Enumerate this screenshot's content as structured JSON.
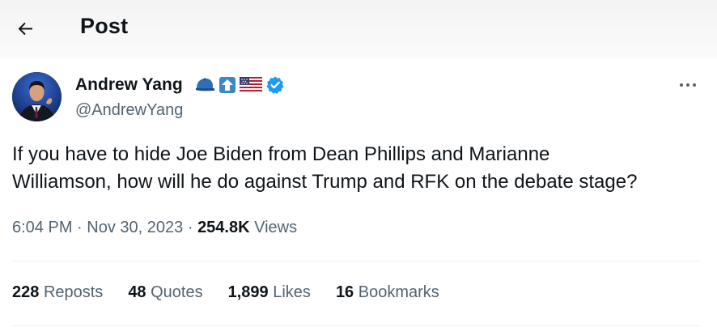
{
  "header": {
    "back_icon": "arrow-left-icon",
    "title": "Post"
  },
  "post": {
    "author": {
      "name": "Andrew Yang",
      "handle": "@AndrewYang",
      "badges": [
        "blue-cap-icon",
        "up-arrow-icon",
        "us-flag-icon",
        "verified-badge-icon"
      ]
    },
    "more_icon": "more-dots-icon",
    "text_lines": [
      "If you have to hide Joe Biden from Dean Phillips and Marianne",
      "Williamson, how will he do against Trump and RFK on the debate stage?"
    ],
    "time": "6:04 PM",
    "separator": "·",
    "date": "Nov 30, 2023",
    "views_count": "254.8K",
    "views_label": "Views",
    "stats": [
      {
        "count": "228",
        "label": "Reposts"
      },
      {
        "count": "48",
        "label": "Quotes"
      },
      {
        "count": "1,899",
        "label": "Likes"
      },
      {
        "count": "16",
        "label": "Bookmarks"
      }
    ]
  },
  "colors": {
    "text_primary": "#0f1419",
    "text_secondary": "#536471",
    "verified_blue": "#1d9bf0",
    "divider": "#eff3f4"
  }
}
